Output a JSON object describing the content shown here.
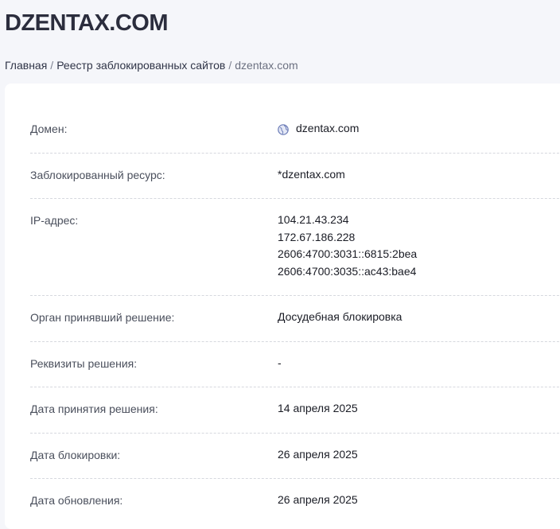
{
  "header": {
    "title": "DZENTAX.COM"
  },
  "breadcrumb": {
    "home": "Главная",
    "registry": "Реестр заблокированных сайтов",
    "current": "dzentax.com",
    "separator": "/"
  },
  "details": {
    "domain": {
      "label": "Домен:",
      "value": "dzentax.com",
      "icon": "globe-icon"
    },
    "blocked_resource": {
      "label": "Заблокированный ресурс:",
      "value": "*dzentax.com"
    },
    "ip": {
      "label": "IP-адрес:",
      "values": [
        "104.21.43.234",
        "172.67.186.228",
        "2606:4700:3031::6815:2bea",
        "2606:4700:3035::ac43:bae4"
      ]
    },
    "authority": {
      "label": "Орган принявший решение:",
      "value": "Досудебная блокировка"
    },
    "requisites": {
      "label": "Реквизиты решения:",
      "value": "-"
    },
    "decision_date": {
      "label": "Дата принятия решения:",
      "value": "14 апреля 2025"
    },
    "block_date": {
      "label": "Дата блокировки:",
      "value": "26 апреля 2025"
    },
    "update_date": {
      "label": "Дата обновления:",
      "value": "26 апреля 2025"
    }
  },
  "colors": {
    "background": "#f5f6fa",
    "card": "#ffffff",
    "title": "#2b2d3d",
    "icon": "#6a7bb6"
  }
}
